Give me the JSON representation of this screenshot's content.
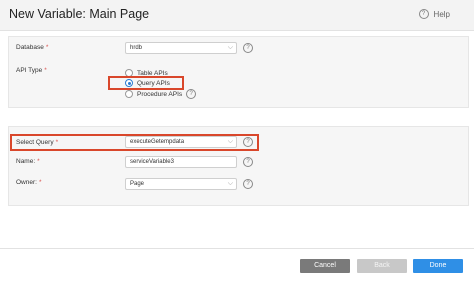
{
  "window": {
    "title": "New Variable: Main Page",
    "help_label": "Help"
  },
  "form": {
    "database": {
      "label": "Database",
      "required": "*",
      "value": "hrdb"
    },
    "api_type": {
      "label": "API Type",
      "required": "*",
      "options": [
        {
          "label": "Table APIs",
          "selected": false
        },
        {
          "label": "Query APIs",
          "selected": true
        },
        {
          "label": "Procedure APIs",
          "selected": false
        }
      ]
    },
    "select_query": {
      "label": "Select Query",
      "required": "*",
      "value": "executeGetempdata"
    },
    "name": {
      "label": "Name:",
      "required": "*",
      "value": "serviceVariable3"
    },
    "owner": {
      "label": "Owner:",
      "required": "*",
      "value": "Page"
    }
  },
  "buttons": {
    "cancel": "Cancel",
    "back": "Back",
    "done": "Done"
  },
  "colors": {
    "highlight": "#d9472b",
    "primary": "#2f8fe6"
  },
  "icons": {
    "help": "question-circle-icon",
    "chevron": "chevron-down-icon"
  }
}
